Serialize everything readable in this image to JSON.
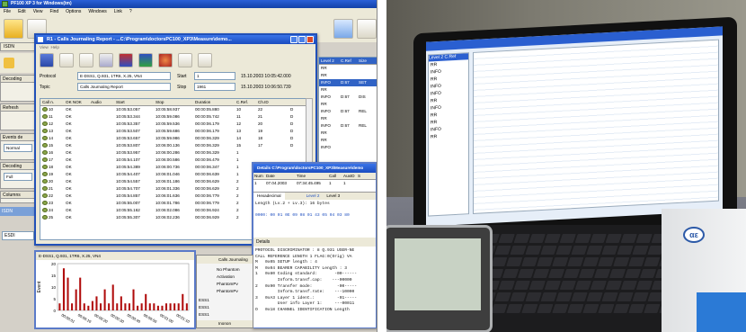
{
  "app": {
    "title": "PF100 XP 3 for Windows(tm)",
    "menu": [
      "File",
      "Edit",
      "View",
      "Find",
      "Options",
      "Windows",
      "Link",
      "?"
    ]
  },
  "side": {
    "isdn_tab": "ISDN",
    "panels": [
      "Decoding",
      "Refresh",
      "Events de",
      "Decoding",
      "Columns"
    ],
    "panel_values": [
      "Normal",
      "Full"
    ],
    "lower_tab": "ISDN",
    "lower_field": "ESDI"
  },
  "report": {
    "title": "R1 - Calls Journaling Report - ...C:\\Program\\doctorsPC100_XP3\\Measure\\demo...",
    "menu": [
      "View",
      "Help"
    ],
    "protocol_label": "Protocol",
    "protocol_value": "E-DSS1, Q.931, 1TR6, X.25, VN4",
    "topic_label": "Topic",
    "topic_value": "Calls Journaling Report",
    "start_label": "Start",
    "start_value": "1",
    "start_time": "15.10.2003   10:05:42.000",
    "stop_label": "Stop",
    "stop_value": "1961",
    "stop_time": "15.10.2003   10:06:50.739",
    "columns": [
      "Call n.",
      "OK NOK",
      "Audio",
      "Start",
      "Stop",
      "Duration",
      "C.Ref.",
      "Ch.ID",
      ""
    ],
    "rows": [
      [
        "10",
        "OK",
        "",
        "10:05:53.057",
        "10:05:58.937",
        "00:00:05.880",
        "10",
        "22",
        "D"
      ],
      [
        "11",
        "OK",
        "",
        "10:05:53.344",
        "10:05:59.086",
        "00:00:05.742",
        "11",
        "21",
        "D"
      ],
      [
        "12",
        "OK",
        "",
        "10:05:53.357",
        "10:05:59.536",
        "00:00:06.179",
        "12",
        "20",
        "D"
      ],
      [
        "13",
        "OK",
        "",
        "10:05:53.507",
        "10:05:59.686",
        "00:00:06.179",
        "13",
        "19",
        "D"
      ],
      [
        "14",
        "OK",
        "",
        "10:05:53.657",
        "10:05:59.986",
        "00:00:06.329",
        "14",
        "18",
        "D"
      ],
      [
        "15",
        "OK",
        "",
        "10:05:53.807",
        "10:06:00.136",
        "00:00:06.329",
        "15",
        "17",
        "D"
      ],
      [
        "16",
        "OK",
        "",
        "10:05:53.957",
        "10:06:00.286",
        "00:00:06.329",
        "1",
        "",
        ""
      ],
      [
        "17",
        "OK",
        "",
        "10:05:54.107",
        "10:06:00.586",
        "00:00:06.479",
        "1",
        "",
        ""
      ],
      [
        "18",
        "OK",
        "",
        "10:05:54.389",
        "10:06:00.736",
        "00:00:06.347",
        "1",
        "",
        ""
      ],
      [
        "19",
        "OK",
        "",
        "10:05:54.407",
        "10:06:01.046",
        "00:00:06.639",
        "1",
        "",
        ""
      ],
      [
        "20",
        "OK",
        "",
        "10:05:54.557",
        "10:06:01.186",
        "00:00:06.629",
        "2",
        "",
        ""
      ],
      [
        "21",
        "OK",
        "",
        "10:05:54.707",
        "10:06:01.336",
        "00:00:06.629",
        "2",
        "",
        ""
      ],
      [
        "22",
        "OK",
        "",
        "10:05:54.857",
        "10:06:01.636",
        "00:00:06.779",
        "2",
        "",
        ""
      ],
      [
        "23",
        "OK",
        "",
        "10:05:55.007",
        "10:06:01.786",
        "00:00:06.779",
        "2",
        "",
        ""
      ],
      [
        "24",
        "OK",
        "",
        "10:05:55.162",
        "10:06:02.086",
        "00:00:06.924",
        "2",
        "",
        ""
      ],
      [
        "25",
        "OK",
        "",
        "10:05:55.307",
        "10:06:02.236",
        "00:00:06.929",
        "2",
        "",
        ""
      ]
    ]
  },
  "right_col": {
    "headers": [
      "Level 2",
      "C.Ref",
      "Size"
    ],
    "rows": [
      [
        "RR",
        "",
        ""
      ],
      [
        "RR",
        "",
        ""
      ],
      [
        "INFO",
        "D:67",
        "SET"
      ],
      [
        "RR",
        "",
        ""
      ],
      [
        "INFO",
        "D:67",
        "DIS"
      ],
      [
        "RR",
        "",
        ""
      ],
      [
        "INFO",
        "D:67",
        "REL"
      ],
      [
        "RR",
        "",
        ""
      ],
      [
        "INFO",
        "D:67",
        "REL"
      ],
      [
        "RR",
        "",
        ""
      ],
      [
        "RR",
        "",
        ""
      ],
      [
        "INFO",
        "",
        ""
      ]
    ]
  },
  "details_win": {
    "title": "Details C:\\Program\\doctorsPC100_XP3\\Measure\\demo",
    "columns": [
      "Num",
      "Date",
      "Time",
      "Call",
      "AuxID",
      "S"
    ],
    "row": [
      "1",
      "07.04.2003",
      "07:34:45.495",
      "1",
      "1",
      ""
    ],
    "tabs": [
      "Hexadecimal",
      "Level 2",
      "Level 3"
    ],
    "hex_length": "Length (Lv.2 + Lv.3): 16 bytes",
    "hex_bytes": "0000: 00 01 0E 09 08 01 43 05 04 03 80",
    "details_label": "Details",
    "decode": [
      "PROTOCOL DISCRIMINATOR : 8 Q.931 USER-NE",
      "CALL REFERENCE LENGTH 1 FLAG:0(Orig) VA",
      "M   0x05 SETUP length : 4",
      "M   0x04 BEARER CAPABILITY Length : 3",
      "1   0x80 Coding standard:       -00------",
      "         Inform.transf.cap:    ---00000",
      "2   0x90 Transfer mode:          -00-----",
      "         Inform.transf.rate:    ---10000",
      "3   0xA3 Layer 1 ident.:         -01-----",
      "         User info Layer 1:     ---00011",
      "O   0x18 CHANNEL IDENTIFICATION Length"
    ]
  },
  "graph": {
    "title": "E-DSS1, Q.931, 1TR6, X.25, VN4",
    "ylabel": "Event",
    "yticks": [
      "20",
      "15",
      "10",
      "5",
      "0"
    ],
    "xticks": [
      "00:00:01",
      "00:00:10",
      "00:00:20",
      "00:00:30",
      "00:00:40",
      "00:00:50",
      "00:01:00",
      "00:01:10"
    ],
    "bars": [
      3,
      18,
      14,
      3,
      9,
      14,
      3,
      2,
      4,
      6,
      3,
      9,
      3,
      11,
      3,
      6,
      3,
      3,
      9,
      2,
      3,
      7,
      3,
      3,
      2,
      2,
      3,
      3,
      3,
      3,
      7,
      3
    ]
  },
  "journal": {
    "header": "Calls Journaling",
    "items": [
      "No Phantom",
      "Activation",
      "PhantomPv",
      "PhantomPv"
    ],
    "codes": [
      "ESS1",
      "ESS1",
      "ESS1"
    ],
    "status": "Inonon"
  },
  "photo_screen": {
    "headers": [
      "Level 2",
      "C.Ref",
      "Size"
    ],
    "rows": [
      "RR",
      "INFO",
      "RR",
      "INFO",
      "INFO",
      "RR",
      "INFO",
      "RR",
      "RR",
      "INFO",
      "RR"
    ]
  },
  "photo_box_logo": "αε",
  "colors": {
    "title_blue": "#1a4cc0",
    "selection": "#3163c5",
    "bars": "#b00c0c",
    "ok_icon": "#8aa64a"
  }
}
